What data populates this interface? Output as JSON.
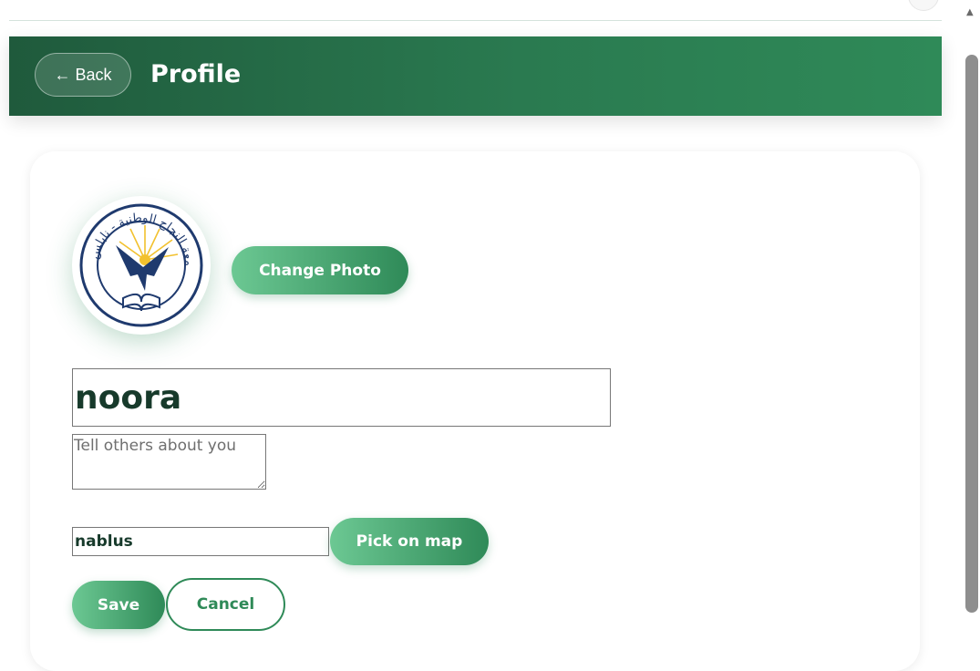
{
  "header": {
    "back_label": "← Back",
    "title": "Profile",
    "gradient_start": "#1f5a3c",
    "gradient_end": "#2f8a58"
  },
  "profile": {
    "avatar_icon": "university-seal-icon",
    "avatar_seal_text": "جامعة النجاح الوطنية - نابلس",
    "change_photo_label": "Change Photo",
    "name_value": "noora",
    "bio_placeholder": "Tell others about you",
    "bio_value": "",
    "city_value": "nablus",
    "pick_map_label": "Pick on map",
    "save_label": "Save",
    "cancel_label": "Cancel"
  },
  "theme": {
    "accent": "#2f8a58",
    "accent_light": "#6cc893",
    "text_dark": "#173a2b"
  },
  "scrollbar": {
    "up_arrow_icon": "scroll-up-arrow-icon"
  }
}
